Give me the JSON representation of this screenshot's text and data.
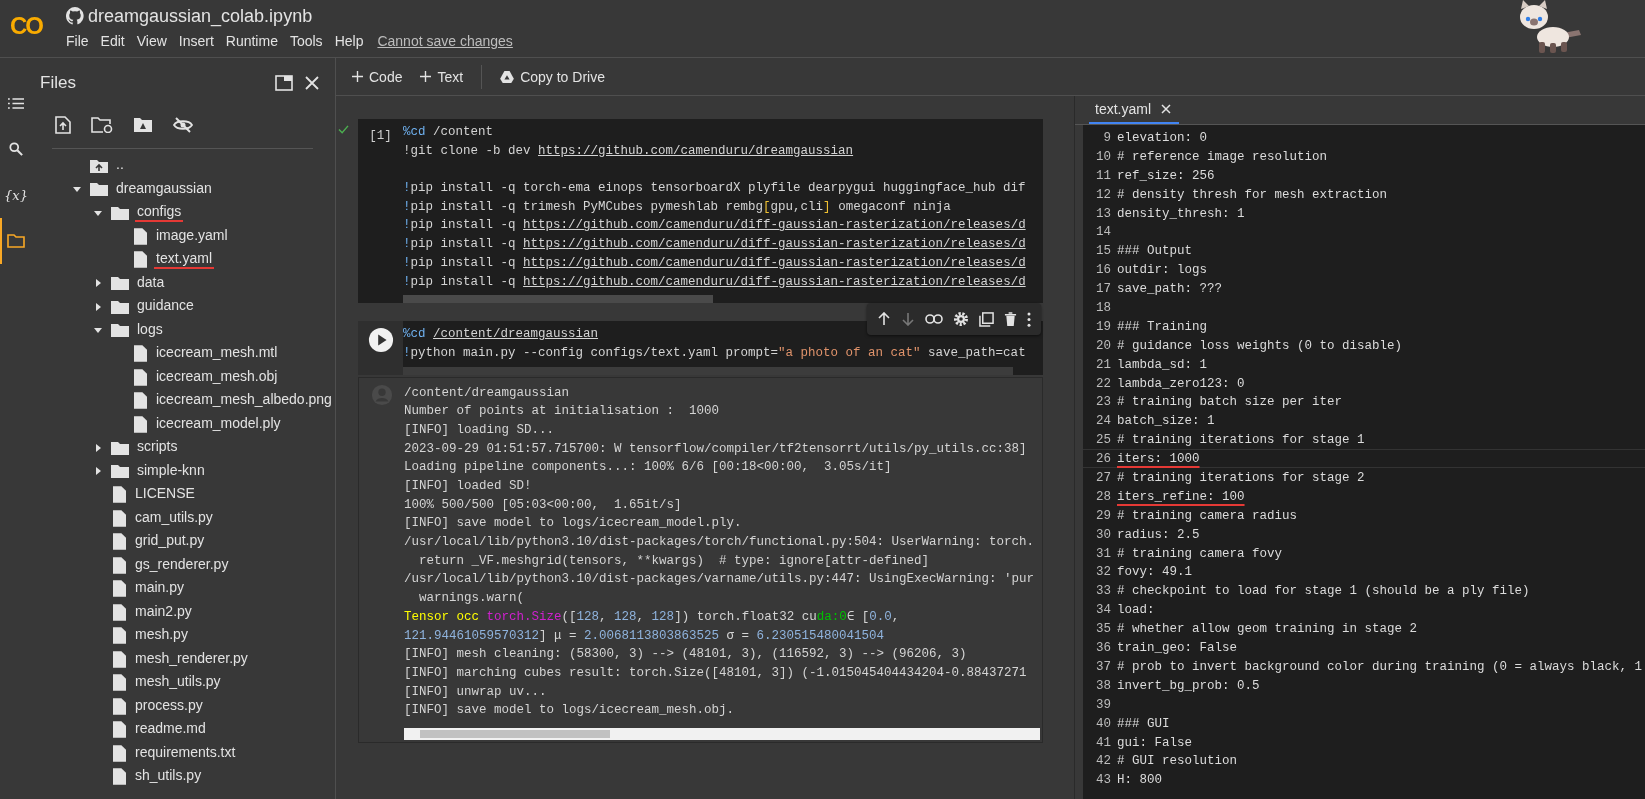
{
  "header": {
    "logo": "CO",
    "title": "dreamgaussian_colab.ipynb",
    "menu": [
      "File",
      "Edit",
      "View",
      "Insert",
      "Runtime",
      "Tools",
      "Help"
    ],
    "save_notice": "Cannot save changes"
  },
  "rail": [
    {
      "kind": "menu",
      "selected": false
    },
    {
      "kind": "search",
      "selected": false
    },
    {
      "kind": "variables",
      "label": "{x}",
      "selected": false
    },
    {
      "kind": "files",
      "selected": true
    }
  ],
  "toolbar": [
    {
      "kind": "add",
      "label": "Code"
    },
    {
      "kind": "add",
      "label": "Text"
    },
    {
      "kind": "drive",
      "label": "Copy to Drive"
    }
  ],
  "files": {
    "title": "Files",
    "tree": [
      {
        "kind": "up",
        "label": "..",
        "underlined": false
      },
      {
        "kind": "folder",
        "label": "dreamgaussian",
        "expanded": true,
        "underlined": false,
        "children": [
          {
            "kind": "folder",
            "label": "configs",
            "expanded": true,
            "underlined": true,
            "children": [
              {
                "kind": "file",
                "label": "image.yaml",
                "underlined": false
              },
              {
                "kind": "file",
                "label": "text.yaml",
                "underlined": true
              }
            ]
          },
          {
            "kind": "folder",
            "label": "data",
            "expanded": false,
            "underlined": false
          },
          {
            "kind": "folder",
            "label": "guidance",
            "expanded": false,
            "underlined": false
          },
          {
            "kind": "folder",
            "label": "logs",
            "expanded": true,
            "underlined": false,
            "children": [
              {
                "kind": "file",
                "label": "icecream_mesh.mtl",
                "underlined": false
              },
              {
                "kind": "file",
                "label": "icecream_mesh.obj",
                "underlined": false
              },
              {
                "kind": "file",
                "label": "icecream_mesh_albedo.png",
                "underlined": false
              },
              {
                "kind": "file",
                "label": "icecream_model.ply",
                "underlined": false
              }
            ]
          },
          {
            "kind": "folder",
            "label": "scripts",
            "expanded": false,
            "underlined": false
          },
          {
            "kind": "folder",
            "label": "simple-knn",
            "expanded": false,
            "underlined": false
          },
          {
            "kind": "file",
            "label": "LICENSE",
            "underlined": false
          },
          {
            "kind": "file",
            "label": "cam_utils.py",
            "underlined": false
          },
          {
            "kind": "file",
            "label": "grid_put.py",
            "underlined": false
          },
          {
            "kind": "file",
            "label": "gs_renderer.py",
            "underlined": false
          },
          {
            "kind": "file",
            "label": "main.py",
            "underlined": false
          },
          {
            "kind": "file",
            "label": "main2.py",
            "underlined": false
          },
          {
            "kind": "file",
            "label": "mesh.py",
            "underlined": false
          },
          {
            "kind": "file",
            "label": "mesh_renderer.py",
            "underlined": false
          },
          {
            "kind": "file",
            "label": "mesh_utils.py",
            "underlined": false
          },
          {
            "kind": "file",
            "label": "process.py",
            "underlined": false
          },
          {
            "kind": "file",
            "label": "readme.md",
            "underlined": false
          },
          {
            "kind": "file",
            "label": "requirements.txt",
            "underlined": false
          },
          {
            "kind": "file",
            "label": "sh_utils.py",
            "underlined": false
          }
        ]
      }
    ]
  },
  "cells": [
    {
      "executed": true,
      "selected": false,
      "exec_count": "[1]",
      "lines": [
        {
          "kind": "tokens",
          "tokens": [
            {
              "text": "%cd",
              "kind": "magic"
            },
            {
              "text": " /content",
              "kind": "plain"
            }
          ]
        },
        {
          "kind": "tokens",
          "tokens": [
            {
              "text": "!git clone -b dev ",
              "kind": "plain"
            },
            {
              "text": "https://github.com/camenduru/dreamgaussian",
              "kind": "link"
            }
          ]
        },
        {
          "kind": "blank"
        },
        {
          "kind": "tokens",
          "tokens": [
            {
              "text": "!",
              "kind": "magic"
            },
            {
              "text": "pip install -q torch-ema einops tensorboardX plyfile dearpygui huggingface_hub dif",
              "kind": "plain"
            }
          ]
        },
        {
          "kind": "tokens",
          "tokens": [
            {
              "text": "!",
              "kind": "magic"
            },
            {
              "text": "pip install -q trimesh PyMCubes pymeshlab rembg",
              "kind": "plain"
            },
            {
              "text": "[",
              "kind": "bracket"
            },
            {
              "text": "gpu,cli",
              "kind": "plain"
            },
            {
              "text": "]",
              "kind": "bracket"
            },
            {
              "text": " omegaconf ninja",
              "kind": "plain"
            }
          ]
        },
        {
          "kind": "tokens",
          "tokens": [
            {
              "text": "!",
              "kind": "magic"
            },
            {
              "text": "pip install -q ",
              "kind": "plain"
            },
            {
              "text": "https://github.com/camenduru/diff-gaussian-rasterization/releases/d",
              "kind": "link"
            }
          ]
        },
        {
          "kind": "tokens",
          "tokens": [
            {
              "text": "!",
              "kind": "magic"
            },
            {
              "text": "pip install -q ",
              "kind": "plain"
            },
            {
              "text": "https://github.com/camenduru/diff-gaussian-rasterization/releases/d",
              "kind": "link"
            }
          ]
        },
        {
          "kind": "tokens",
          "tokens": [
            {
              "text": "!",
              "kind": "magic"
            },
            {
              "text": "pip install -q ",
              "kind": "plain"
            },
            {
              "text": "https://github.com/camenduru/diff-gaussian-rasterization/releases/d",
              "kind": "link"
            }
          ]
        },
        {
          "kind": "tokens",
          "tokens": [
            {
              "text": "!",
              "kind": "magic"
            },
            {
              "text": "pip install -q ",
              "kind": "plain"
            },
            {
              "text": "https://github.com/camenduru/diff-gaussian-rasterization/releases/d",
              "kind": "link"
            }
          ]
        }
      ]
    },
    {
      "executed": false,
      "selected": true,
      "lines": [
        {
          "kind": "tokens",
          "tokens": [
            {
              "text": "%cd ",
              "kind": "magic"
            },
            {
              "text": "/content/dreamgaussian",
              "kind": "link"
            }
          ]
        },
        {
          "kind": "tokens",
          "tokens": [
            {
              "text": "!",
              "kind": "magic"
            },
            {
              "text": "python main.py --config configs/text.yaml prompt=",
              "kind": "plain"
            },
            {
              "text": "\"a photo of an cat\"",
              "kind": "string"
            },
            {
              "text": " save_path=cat",
              "kind": "plain"
            }
          ]
        }
      ],
      "output": [
        {
          "kind": "text",
          "text": "/content/dreamgaussian"
        },
        {
          "kind": "text",
          "text": "Number of points at initialisation :  1000"
        },
        {
          "kind": "text",
          "text": "[INFO] loading SD..."
        },
        {
          "kind": "text",
          "text": "2023-09-29 01:51:57.715700: W tensorflow/compiler/tf2tensorrt/utils/py_utils.cc:38]"
        },
        {
          "kind": "text",
          "text": "Loading pipeline components...: 100% 6/6 [00:18<00:00,  3.05s/it]"
        },
        {
          "kind": "text",
          "text": "[INFO] loaded SD!"
        },
        {
          "kind": "text",
          "text": "100% 500/500 [05:03<00:00,  1.65it/s]"
        },
        {
          "kind": "text",
          "text": "[INFO] save model to logs/icecream_model.ply."
        },
        {
          "kind": "text",
          "text": "/usr/local/lib/python3.10/dist-packages/torch/functional.py:504: UserWarning: torch."
        },
        {
          "kind": "text",
          "text": "  return _VF.meshgrid(tensors, **kwargs)  # type: ignore[attr-defined]"
        },
        {
          "kind": "text",
          "text": "/usr/local/lib/python3.10/dist-packages/varname/utils.py:447: UsingExecWarning: 'pur"
        },
        {
          "kind": "text",
          "text": "  warnings.warn("
        },
        {
          "kind": "tokens",
          "tokens": [
            {
              "text": "Tensor occ ",
              "kind": "label"
            },
            {
              "text": "torch.Size",
              "kind": "func"
            },
            {
              "text": "([",
              "kind": "plain"
            },
            {
              "text": "128",
              "kind": "number"
            },
            {
              "text": ", ",
              "kind": "plain"
            },
            {
              "text": "128",
              "kind": "number"
            },
            {
              "text": ", ",
              "kind": "plain"
            },
            {
              "text": "128",
              "kind": "number"
            },
            {
              "text": "]) torch.float32 cu",
              "kind": "plain"
            },
            {
              "text": "da:0",
              "kind": "device"
            },
            {
              "text": "∈ [",
              "kind": "plain"
            },
            {
              "text": "0.0",
              "kind": "number"
            },
            {
              "text": ",",
              "kind": "plain"
            }
          ]
        },
        {
          "kind": "tokens",
          "tokens": [
            {
              "text": "121.94461059570312",
              "kind": "number"
            },
            {
              "text": "] μ = ",
              "kind": "plain"
            },
            {
              "text": "2.0068113803863525",
              "kind": "number"
            },
            {
              "text": " σ = ",
              "kind": "plain"
            },
            {
              "text": "6.230515480041504",
              "kind": "number"
            }
          ]
        },
        {
          "kind": "text",
          "text": "[INFO] mesh cleaning: (58300, 3) --> (48101, 3), (116592, 3) --> (96206, 3)"
        },
        {
          "kind": "text",
          "text": "[INFO] marching cubes result: torch.Size([48101, 3]) (-1.015045404434204-0.88437271"
        },
        {
          "kind": "text",
          "text": "[INFO] unwrap uv..."
        },
        {
          "kind": "text",
          "text": "[INFO] save model to logs/icecream_mesh.obj."
        }
      ]
    }
  ],
  "editor": {
    "tabs": [
      {
        "label": "text.yaml",
        "selected": true
      }
    ],
    "lines": [
      {
        "n": "9",
        "text": "elevation: 0",
        "current": false,
        "underlined": false
      },
      {
        "n": "10",
        "text": "# reference image resolution",
        "current": false,
        "underlined": false
      },
      {
        "n": "11",
        "text": "ref_size: 256",
        "current": false,
        "underlined": false
      },
      {
        "n": "12",
        "text": "# density thresh for mesh extraction",
        "current": false,
        "underlined": false
      },
      {
        "n": "13",
        "text": "density_thresh: 1",
        "current": false,
        "underlined": false
      },
      {
        "n": "14",
        "current": false,
        "underlined": false
      },
      {
        "n": "15",
        "text": "### Output",
        "current": false,
        "underlined": false
      },
      {
        "n": "16",
        "text": "outdir: logs",
        "current": false,
        "underlined": false
      },
      {
        "n": "17",
        "text": "save_path: ???",
        "current": false,
        "underlined": false
      },
      {
        "n": "18",
        "current": false,
        "underlined": false
      },
      {
        "n": "19",
        "text": "### Training",
        "current": false,
        "underlined": false
      },
      {
        "n": "20",
        "text": "# guidance loss weights (0 to disable)",
        "current": false,
        "underlined": false
      },
      {
        "n": "21",
        "text": "lambda_sd: 1",
        "current": false,
        "underlined": false
      },
      {
        "n": "22",
        "text": "lambda_zero123: 0",
        "current": false,
        "underlined": false
      },
      {
        "n": "23",
        "text": "# training batch size per iter",
        "current": false,
        "underlined": false
      },
      {
        "n": "24",
        "text": "batch_size: 1",
        "current": false,
        "underlined": false
      },
      {
        "n": "25",
        "text": "# training iterations for stage 1",
        "current": false,
        "underlined": false
      },
      {
        "n": "26",
        "text": "iters: 1000",
        "current": true,
        "underlined": true
      },
      {
        "n": "27",
        "text": "# training iterations for stage 2",
        "current": false,
        "underlined": false
      },
      {
        "n": "28",
        "text": "iters_refine: 100",
        "current": false,
        "underlined": true
      },
      {
        "n": "29",
        "text": "# training camera radius",
        "current": false,
        "underlined": false
      },
      {
        "n": "30",
        "text": "radius: 2.5",
        "current": false,
        "underlined": false
      },
      {
        "n": "31",
        "text": "# training camera fovy",
        "current": false,
        "underlined": false
      },
      {
        "n": "32",
        "text": "fovy: 49.1",
        "current": false,
        "underlined": false
      },
      {
        "n": "33",
        "text": "# checkpoint to load for stage 1 (should be a ply file)",
        "current": false,
        "underlined": false
      },
      {
        "n": "34",
        "text": "load:",
        "current": false,
        "underlined": false
      },
      {
        "n": "35",
        "text": "# whether allow geom training in stage 2",
        "current": false,
        "underlined": false
      },
      {
        "n": "36",
        "text": "train_geo: False",
        "current": false,
        "underlined": false
      },
      {
        "n": "37",
        "text": "# prob to invert background color during training (0 = always black, 1",
        "current": false,
        "underlined": false
      },
      {
        "n": "38",
        "text": "invert_bg_prob: 0.5",
        "current": false,
        "underlined": false
      },
      {
        "n": "39",
        "current": false,
        "underlined": false
      },
      {
        "n": "40",
        "text": "### GUI",
        "current": false,
        "underlined": false
      },
      {
        "n": "41",
        "text": "gui: False",
        "current": false,
        "underlined": false
      },
      {
        "n": "42",
        "text": "# GUI resolution",
        "current": false,
        "underlined": false
      },
      {
        "n": "43",
        "text": "H: 800",
        "current": false,
        "underlined": false
      }
    ]
  }
}
